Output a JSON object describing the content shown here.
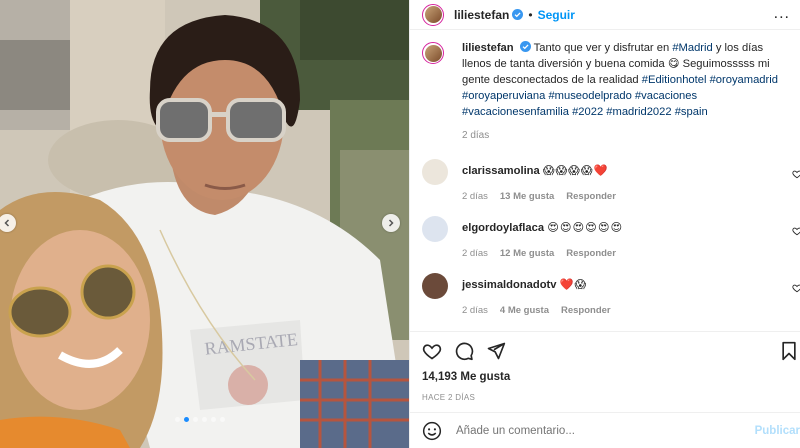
{
  "post": {
    "username": "liliestefan",
    "separator": "•",
    "follow_label": "Seguir",
    "more_label": "...",
    "caption_user": "liliestefan",
    "caption_text": "Tanto que ver y disfrutar en",
    "caption_tag_1": "#Madrid",
    "caption_text_2": "y los días llenos de tanta diversión y buena comida 😋 Seguimosssss mi gente desconectados de la realidad",
    "caption_tags": "#Editionhotel #oroyamadrid #oroyaperuviana #museodelprado #vacaciones #vacacionesenfamilia #2022 #madrid2022 #spain",
    "caption_time": "2 días"
  },
  "comments": [
    {
      "user": "clarissamolina",
      "text": "😱😱😱😱❤️",
      "time": "2 días",
      "likes": "13 Me gusta",
      "reply": "Responder",
      "avatar_color": "#e9e3da"
    },
    {
      "user": "elgordoylaflaca",
      "text": "😍😍😍😍😍😍",
      "time": "2 días",
      "likes": "12 Me gusta",
      "reply": "Responder",
      "avatar_color": "#dfe6f0"
    },
    {
      "user": "jessimaldonadotv",
      "text": "❤️😱",
      "time": "2 días",
      "likes": "4 Me gusta",
      "reply": "Responder",
      "avatar_color": "#6b4a3a"
    }
  ],
  "footer": {
    "likes_count": "14,193 Me gusta",
    "posted_ago": "HACE 2 DÍAS",
    "comment_placeholder": "Añade un comentario...",
    "publish_label": "Publicar"
  },
  "carousel": {
    "total_dots": 6,
    "active_dot": 2
  },
  "colors": {
    "link": "#0095f6",
    "hashtag": "#00376b",
    "muted": "#8e8e8e",
    "publish_disabled": "#b2dffc",
    "heart": "#ed4956"
  }
}
